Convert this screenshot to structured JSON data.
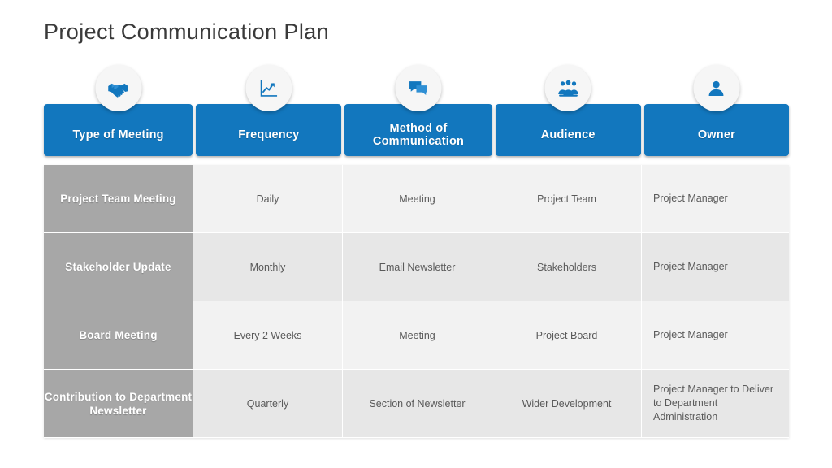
{
  "slide": {
    "title": "Project Communication Plan",
    "colors": {
      "header_blue": "#1277be",
      "first_column_gray": "#a7a7a7",
      "row_light": "#f2f2f2",
      "row_dark": "#e7e7e7",
      "title_text": "#3a3a3a",
      "cell_text": "#5a5a5a",
      "bubble_bg": "#f6f6f6"
    }
  },
  "headers": [
    {
      "label": "Type of Meeting",
      "icon": "handshake-icon"
    },
    {
      "label": "Frequency",
      "icon": "line-chart-icon"
    },
    {
      "label": "Method of\nCommunication",
      "icon": "speech-bubbles-icon"
    },
    {
      "label": "Audience",
      "icon": "people-group-icon"
    },
    {
      "label": "Owner",
      "icon": "person-icon"
    }
  ],
  "header_labels": {
    "type_of_meeting": "Type of Meeting",
    "frequency": "Frequency",
    "method_line1": "Method of",
    "method_line2": "Communication",
    "audience": "Audience",
    "owner": "Owner"
  },
  "table": {
    "columns": [
      "Type of Meeting",
      "Frequency",
      "Method of Communication",
      "Audience",
      "Owner"
    ],
    "rows": [
      {
        "type": "Project Team Meeting",
        "frequency": "Daily",
        "method": "Meeting",
        "audience": "Project Team",
        "owner": "Project Manager"
      },
      {
        "type": "Stakeholder Update",
        "frequency": "Monthly",
        "method": "Email Newsletter",
        "audience": "Stakeholders",
        "owner": "Project Manager"
      },
      {
        "type": "Board Meeting",
        "frequency": "Every 2 Weeks",
        "method": "Meeting",
        "audience": "Project Board",
        "owner": "Project Manager"
      },
      {
        "type": "Contribution to Department Newsletter",
        "frequency": "Quarterly",
        "method": "Section of Newsletter",
        "audience": "Wider Development",
        "owner": "Project Manager to Deliver to Department Administration"
      }
    ]
  }
}
